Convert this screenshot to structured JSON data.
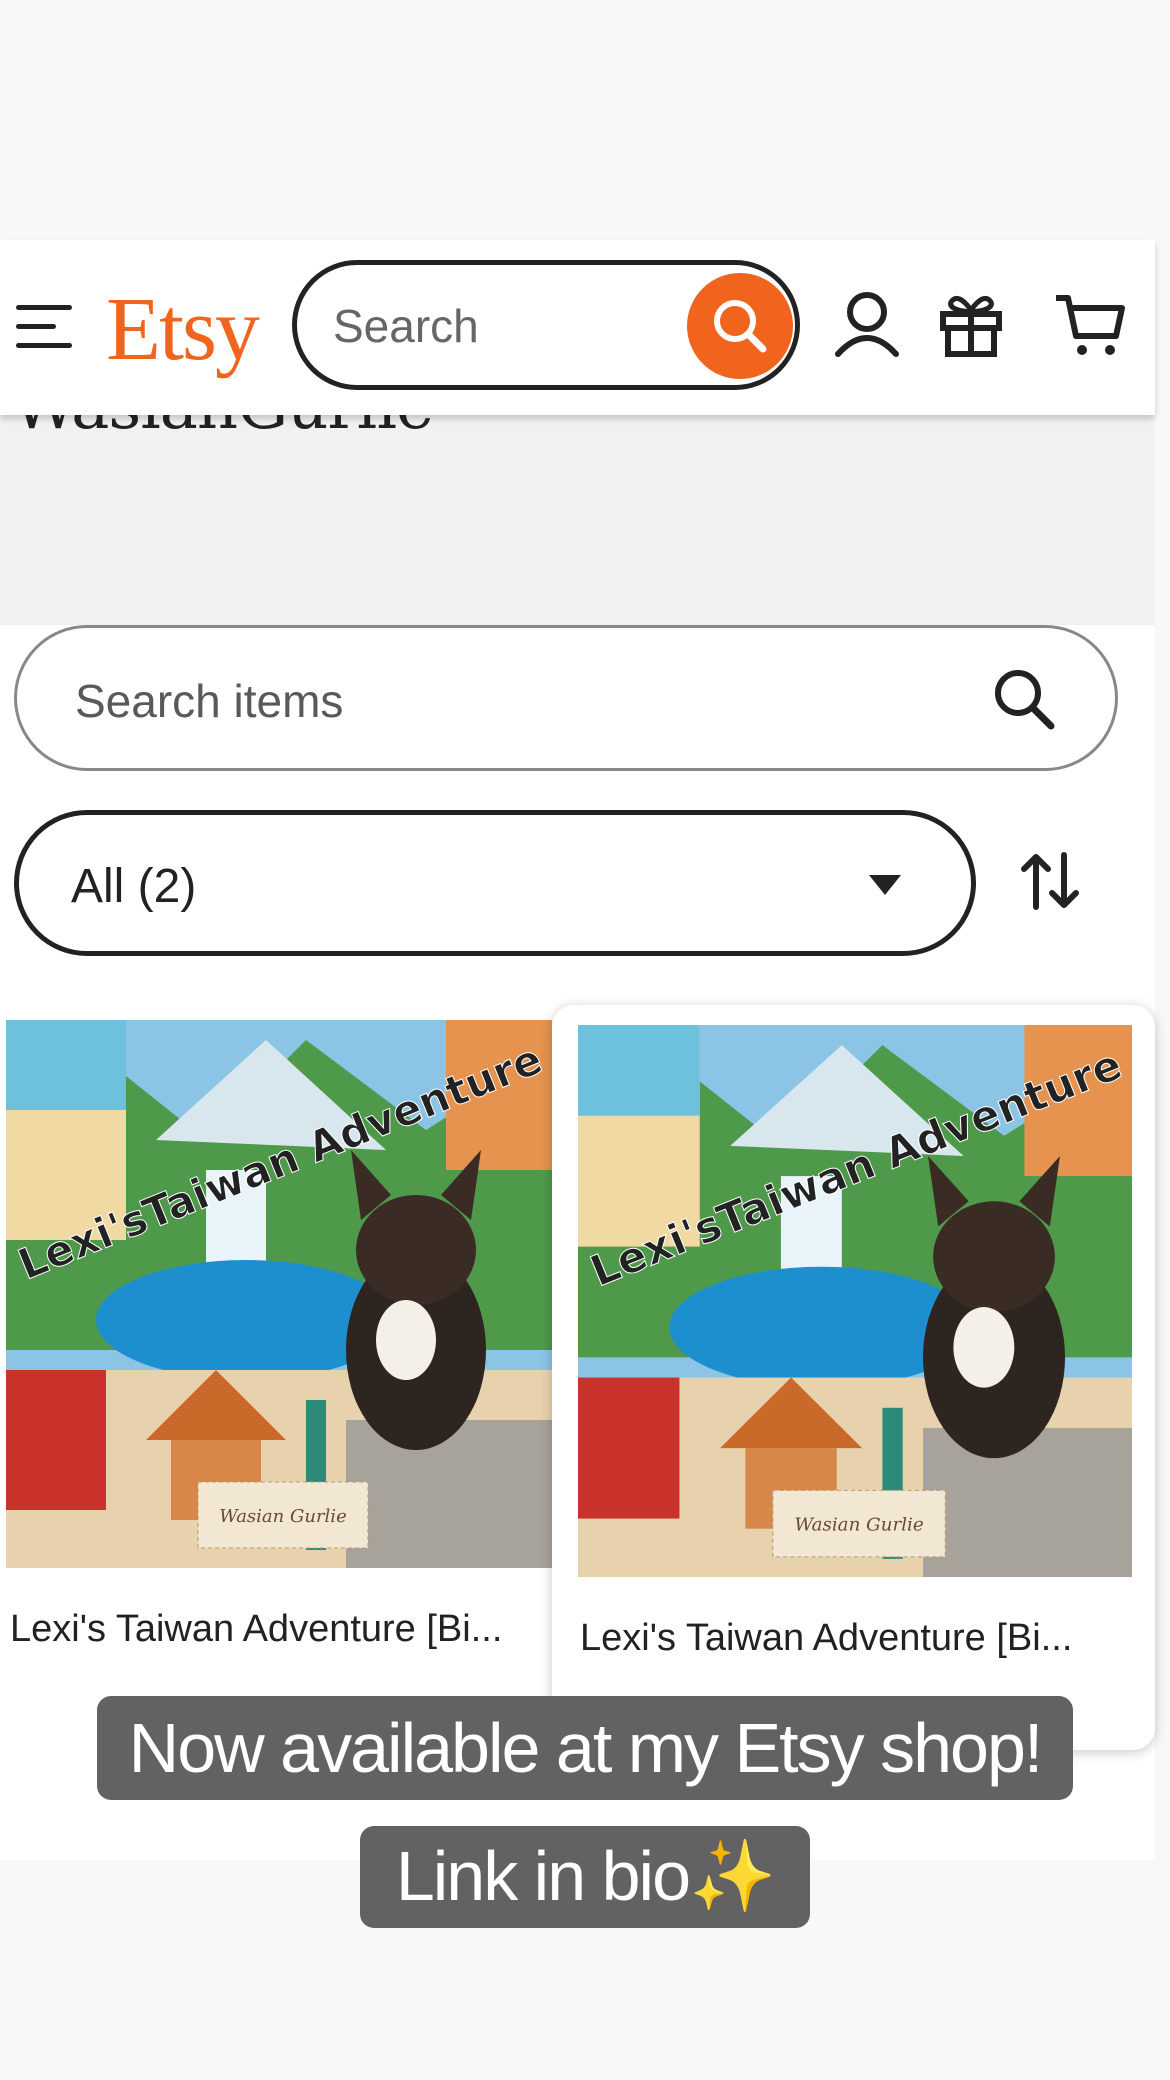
{
  "shop": {
    "name": "WasianGurlie"
  },
  "header": {
    "logo": "Etsy",
    "search_placeholder": "Search",
    "icons": [
      "menu-icon",
      "search-icon",
      "account-icon",
      "gift-icon",
      "cart-icon"
    ]
  },
  "items_search": {
    "placeholder": "Search items"
  },
  "filter": {
    "selected": "All (2)"
  },
  "listings": [
    {
      "title": "Lexi's Taiwan Adventure [Bi...",
      "image_text": "Lexi'sTaiwan Adventure",
      "stamp": "Wasian Gurlie"
    },
    {
      "title": "Lexi's Taiwan Adventure [Bi...",
      "image_text": "Lexi'sTaiwan Adventure",
      "stamp": "Wasian Gurlie"
    }
  ],
  "caption": {
    "line1": "Now available at my Etsy shop!",
    "line2": "Link in bio✨"
  },
  "colors": {
    "brand": "#f1641e",
    "text": "#222222",
    "overlay": "#555555"
  }
}
